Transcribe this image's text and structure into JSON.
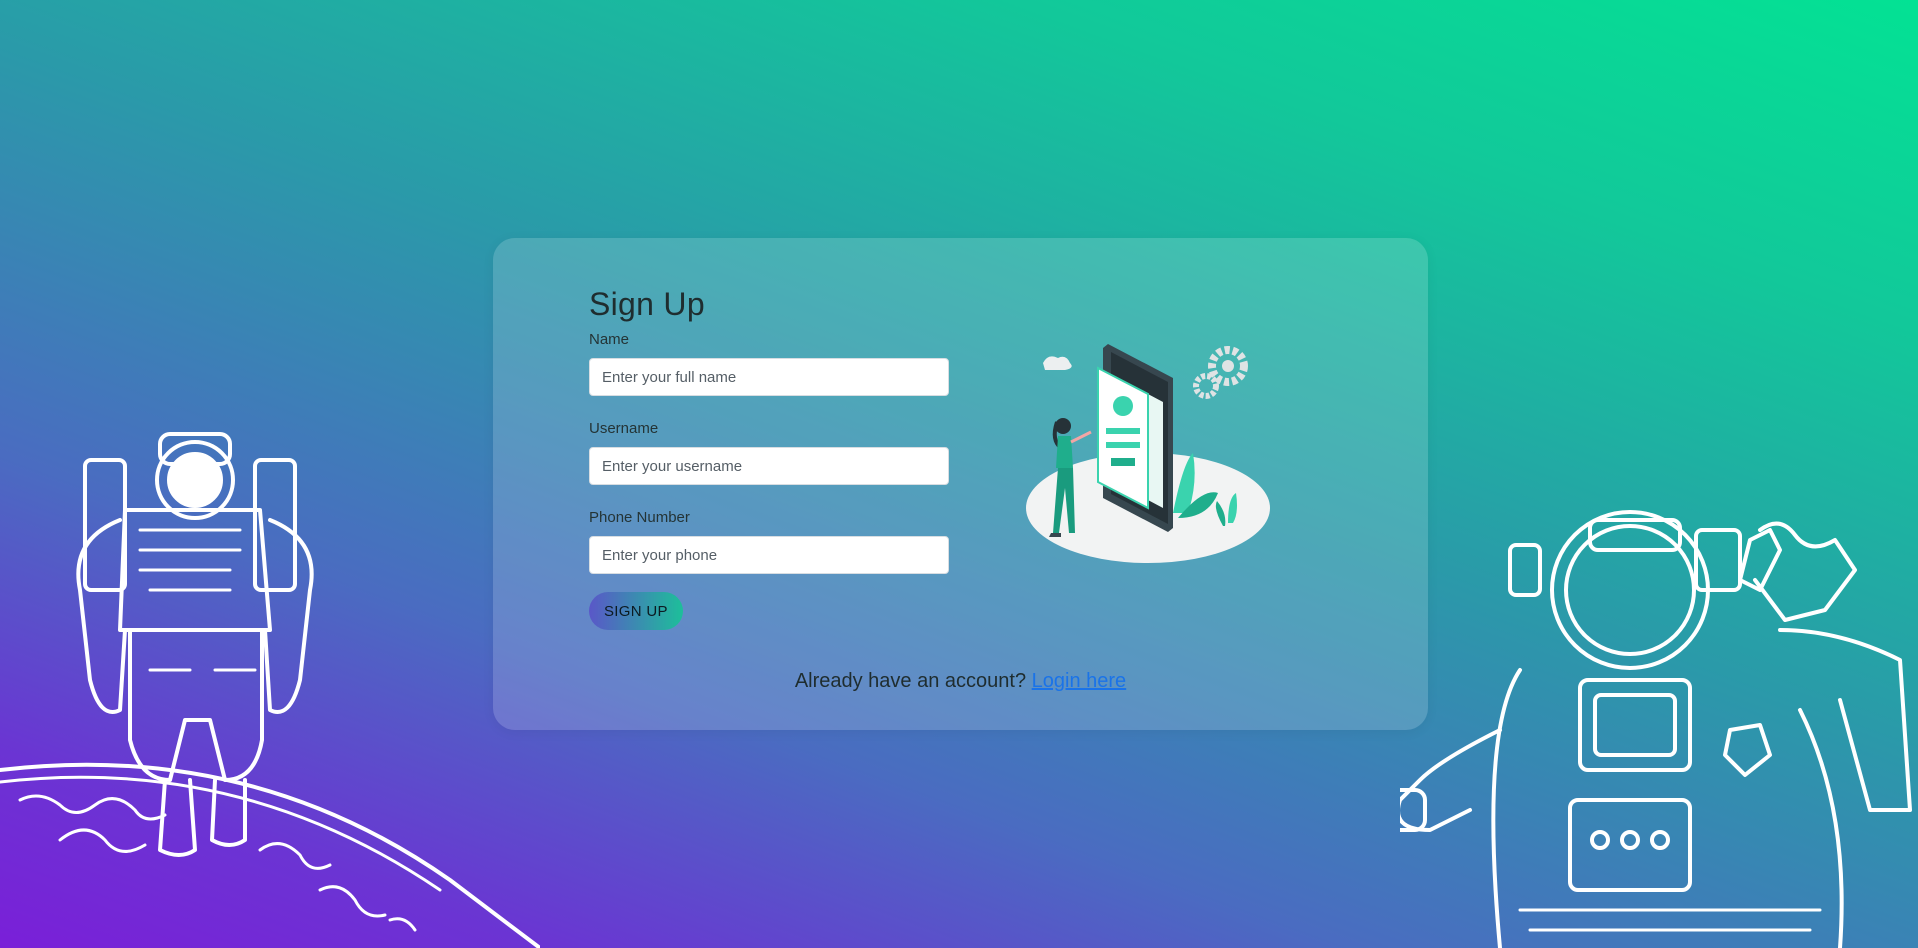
{
  "signup": {
    "title": "Sign Up",
    "fields": [
      {
        "label": "Name",
        "placeholder": "Enter your full name",
        "value": ""
      },
      {
        "label": "Username",
        "placeholder": "Enter your username",
        "value": ""
      },
      {
        "label": "Phone Number",
        "placeholder": "Enter your phone",
        "value": ""
      }
    ],
    "submit_label": "SIGN UP"
  },
  "footer": {
    "prompt": "Already have an account?",
    "link_label": "Login here"
  },
  "illustration": {
    "icon": "phone-profile-illustration"
  },
  "decor": {
    "left": "astronaut-on-planet-icon",
    "right": "astronaut-saluting-icon"
  },
  "colors": {
    "gradient_top_right": "#03e294",
    "gradient_bottom_left": "#7a1fd8",
    "button_start": "#5a57c8",
    "button_end": "#1dbf9a",
    "link": "#1a73e8"
  }
}
